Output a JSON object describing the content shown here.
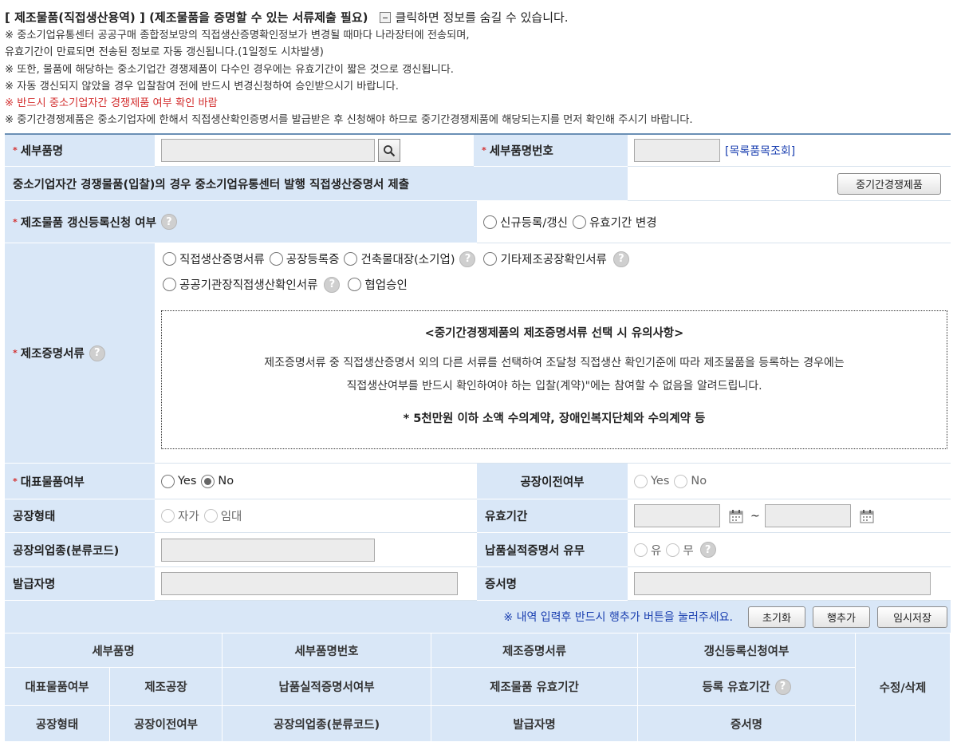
{
  "header": {
    "title": "[ 제조물품(직접생산용역) ] (제조물품을 증명할 수 있는 서류제출 필요)",
    "toggle_text": "클릭하면 정보를 숨길 수 있습니다.",
    "notes": [
      "※ 중소기업유통센터 공공구매 종합정보망의 직접생산증명확인정보가 변경될 때마다 나라장터에 전송되며,",
      "유효기간이 만료되면 전송된 정보로 자동 갱신됩니다.(1일정도 시차발생)",
      "※ 또한, 물품에 해당하는 중소기업간 경쟁제품이 다수인 경우에는 유효기간이 짧은 것으로 갱신됩니다.",
      "※ 자동 갱신되지 않았을 경우 입찰참여 전에 반드시 변경신청하여 승인받으시기 바랍니다.",
      "※ 반드시 중소기업자간 경쟁제품 여부 확인 바람",
      "※ 중기간경쟁제품은 중소기업자에 한해서 직접생산확인증명서를 발급받은 후 신청해야 하므로 중기간경쟁제품에 해당되는지를 먼저 확인해 주시기 바랍니다."
    ]
  },
  "form": {
    "req_mark": "*",
    "detail_name_label": "세부품명",
    "detail_no_label": "세부품명번호",
    "catalog_link": "[목록품목조회]",
    "sme_notice": "중소기업자간 경쟁물품(입찰)의 경우 중소기업유통센터 발행 직접생산증명서 제출",
    "sme_button": "중기간경쟁제품",
    "renew_label": "제조물품 갱신등록신청 여부",
    "renew_options": [
      "신규등록/갱신",
      "유효기간 변경"
    ],
    "proof_label": "제조증명서류",
    "proof_options_row1": [
      "직접생산증명서류",
      "공장등록증",
      "건축물대장(소기업)",
      "기타제조공장확인서류"
    ],
    "proof_options_row2": [
      "공공기관장직접생산확인서류",
      "협업승인"
    ],
    "notice_title": "<중기간경쟁제품의 제조증명서류 선택 시 유의사항>",
    "notice_line1": "제조증명서류 중 직접생산증명서 외의 다른 서류를 선택하여 조달청 직접생산 확인기준에 따라 제조물품을 등록하는 경우에는",
    "notice_line2": "직접생산여부를 반드시 확인하여야 하는 입찰(계약)\"에는 참여할 수 없음을 알려드립니다.",
    "notice_foot": "* 5천만원 이하 소액 수의계약, 장애인복지단체와 수의계약 등",
    "rep_label": "대표물품여부",
    "rep_yes": "Yes",
    "rep_no": "No",
    "move_label": "공장이전여부",
    "move_yes": "Yes",
    "move_no": "No",
    "factory_type_label": "공장형태",
    "factory_type_options": [
      "자가",
      "임대"
    ],
    "validity_label": "유효기간",
    "tilde": "~",
    "industry_label": "공장의업종(분류코드)",
    "delivery_label": "납품실적증명서 유무",
    "delivery_options": [
      "유",
      "무"
    ],
    "issuer_label": "발급자명",
    "cert_label": "증서명"
  },
  "actions": {
    "note": "※ 내역 입력후 반드시 행추가 버튼을 눌러주세요.",
    "reset": "초기화",
    "add_row": "행추가",
    "temp_save": "임시저장"
  },
  "list_header": {
    "detail_name": "세부품명",
    "detail_no": "세부품명번호",
    "proof": "제조증명서류",
    "renew": "갱신등록신청여부",
    "rep": "대표물품여부",
    "factory": "제조공장",
    "delivery": "납품실적증명서여부",
    "validity": "제조물품 유효기간",
    "reg_validity": "등록 유효기간",
    "edit_delete": "수정/삭제",
    "factory_type": "공장형태",
    "move": "공장이전여부",
    "industry": "공장의업종(분류코드)",
    "issuer": "발급자명",
    "cert": "증서명"
  }
}
